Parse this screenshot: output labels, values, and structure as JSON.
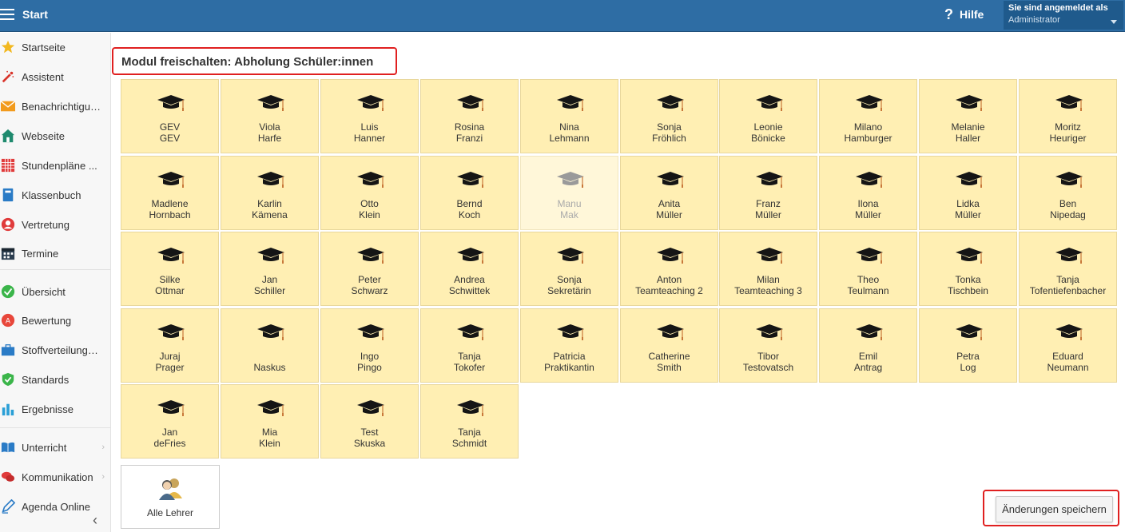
{
  "header": {
    "title": "Start",
    "help_label": "Hilfe",
    "user_line1": "Sie sind angemeldet als",
    "user_line2": "Administrator",
    "color": "#2e6da4"
  },
  "sidebar": {
    "items": [
      {
        "label": "Startseite",
        "icon": "star-icon"
      },
      {
        "label": "Assistent",
        "icon": "magic-wand-icon"
      },
      {
        "label": "Benachrichtigungen",
        "icon": "envelope-icon"
      },
      {
        "label": "Webseite",
        "icon": "house-icon"
      },
      {
        "label": "Stundenpläne ...",
        "icon": "timetable-icon"
      },
      {
        "label": "Klassenbuch",
        "icon": "book-icon"
      },
      {
        "label": "Vertretung",
        "icon": "person-icon"
      },
      {
        "label": "Termine",
        "icon": "calendar-icon"
      },
      {
        "label": "Übersicht",
        "icon": "check-circle-icon"
      },
      {
        "label": "Bewertung",
        "icon": "rating-icon"
      },
      {
        "label": "Stoffverteilungspläne",
        "icon": "briefcase-icon"
      },
      {
        "label": "Standards",
        "icon": "shield-check-icon"
      },
      {
        "label": "Ergebnisse",
        "icon": "bar-chart-icon"
      },
      {
        "label": "Unterricht",
        "icon": "open-book-icon"
      },
      {
        "label": "Kommunikation",
        "icon": "chat-icon"
      },
      {
        "label": "Agenda Online",
        "icon": "pen-icon"
      }
    ],
    "collapse_icon": "chevron-left-icon"
  },
  "main": {
    "title": "Modul freischalten: Abholung Schüler:innen",
    "tiles": [
      [
        "GEV",
        "GEV"
      ],
      [
        "Viola",
        "Harfe"
      ],
      [
        "Luis",
        "Hanner"
      ],
      [
        "Rosina",
        "Franzi"
      ],
      [
        "Nina",
        "Lehmann"
      ],
      [
        "Sonja",
        "Fröhlich"
      ],
      [
        "Leonie",
        "Bönicke"
      ],
      [
        "Milano",
        "Hamburger"
      ],
      [
        "Melanie",
        "Haller"
      ],
      [
        "Moritz",
        "Heuriger"
      ],
      [
        "Madlene",
        "Hornbach"
      ],
      [
        "Karlin",
        "Kämena"
      ],
      [
        "Otto",
        "Klein"
      ],
      [
        "Bernd",
        "Koch"
      ],
      [
        "Manu",
        "Mak"
      ],
      [
        "Anita",
        "Müller"
      ],
      [
        "Franz",
        "Müller"
      ],
      [
        "Ilona",
        "Müller"
      ],
      [
        "Lidka",
        "Müller"
      ],
      [
        "Ben",
        "Nipedag"
      ],
      [
        "Silke",
        "Ottmar"
      ],
      [
        "Jan",
        "Schiller"
      ],
      [
        "Peter",
        "Schwarz"
      ],
      [
        "Andrea",
        "Schwittek"
      ],
      [
        "Sonja",
        "Sekretärin"
      ],
      [
        "Anton",
        "Teamteaching 2"
      ],
      [
        "Milan",
        "Teamteaching 3"
      ],
      [
        "Theo",
        "Teulmann"
      ],
      [
        "Tonka",
        "Tischbein"
      ],
      [
        "Tanja",
        "Tofentiefenbacher"
      ],
      [
        "Juraj",
        "Prager"
      ],
      [
        "",
        "Naskus"
      ],
      [
        "Ingo",
        "Pingo"
      ],
      [
        "Tanja",
        "Tokofer"
      ],
      [
        "Patricia",
        "Praktikantin"
      ],
      [
        "Catherine",
        "Smith"
      ],
      [
        "Tibor",
        "Testovatsch"
      ],
      [
        "Emil",
        "Antrag"
      ],
      [
        "Petra",
        "Log"
      ],
      [
        "Eduard",
        "Neumann"
      ],
      [
        "Jan",
        "deFries"
      ],
      [
        "Mia",
        "Klein"
      ],
      [
        "Test",
        "Skuska"
      ],
      [
        "Tanja",
        "Schmidt"
      ]
    ],
    "disabled_tiles": [
      "Manu Mak"
    ],
    "tile_color": "#ffefb3",
    "all_teachers_label": "Alle Lehrer",
    "save_label": "Änderungen speichern"
  }
}
